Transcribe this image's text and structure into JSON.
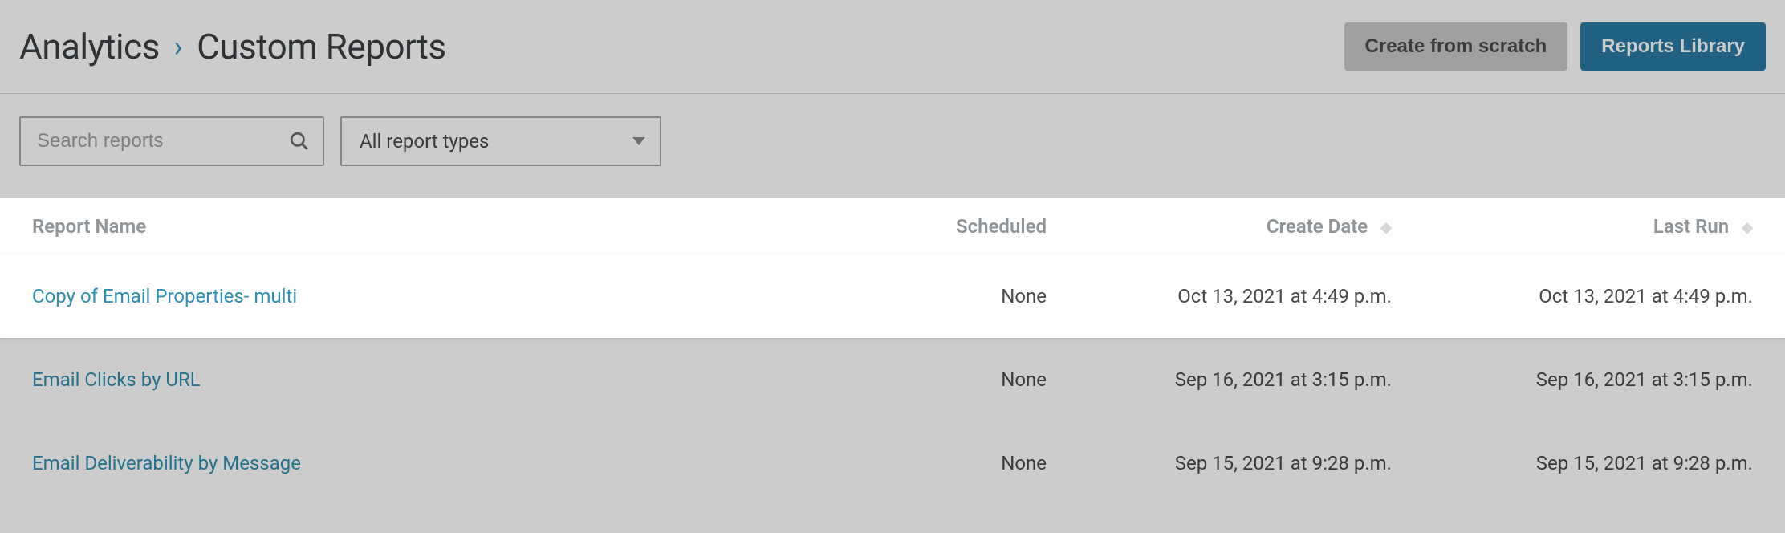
{
  "breadcrumb": {
    "root": "Analytics",
    "current": "Custom Reports"
  },
  "header": {
    "create_from_scratch": "Create from scratch",
    "reports_library": "Reports Library"
  },
  "filters": {
    "search_placeholder": "Search reports",
    "report_type_label": "All report types"
  },
  "table": {
    "columns": {
      "name": "Report Name",
      "scheduled": "Scheduled",
      "create_date": "Create Date",
      "last_run": "Last Run"
    },
    "rows": [
      {
        "name": "Copy of Email Properties- multi",
        "scheduled": "None",
        "create_date": "Oct 13, 2021 at 4:49 p.m.",
        "last_run": "Oct 13, 2021 at 4:49 p.m.",
        "highlighted": true
      },
      {
        "name": "Email Clicks by URL",
        "scheduled": "None",
        "create_date": "Sep 16, 2021 at 3:15 p.m.",
        "last_run": "Sep 16, 2021 at 3:15 p.m.",
        "highlighted": false
      },
      {
        "name": "Email Deliverability by Message",
        "scheduled": "None",
        "create_date": "Sep 15, 2021 at 9:28 p.m.",
        "last_run": "Sep 15, 2021 at 9:28 p.m.",
        "highlighted": false
      }
    ]
  }
}
